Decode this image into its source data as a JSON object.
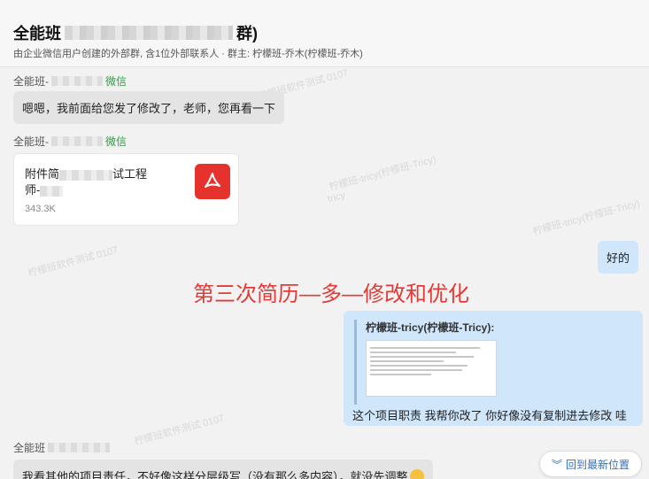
{
  "header": {
    "title_prefix": "全能班",
    "title_suffix": "群)",
    "subtitle": "由企业微信用户创建的外部群, 含1位外部联系人 · 群主: 柠檬班-乔木(柠檬班-乔木)"
  },
  "messages": [
    {
      "sender_prefix": "全能班-",
      "sender_tag": "微信",
      "text": "嗯嗯，我前面给您发了修改了，老师，您再看一下"
    },
    {
      "sender_prefix": "全能班-",
      "sender_tag": "微信",
      "file": {
        "name_prefix": "附件简",
        "name_mid": "试工程",
        "name_suffix": "师-",
        "size": "343.3K",
        "icon": "pdf-icon"
      }
    },
    {
      "outgoing": true,
      "text": "好的"
    },
    {
      "outgoing": true,
      "quote_author": "柠檬班-tricy(柠檬班-Tricy):",
      "text": "这个项目职责 我帮你改了  你好像没有复制进去修改 哇"
    },
    {
      "sender_prefix": "全能班",
      "text": "我看其他的项目责任，不好像这样分层级写（没有那么多内容），就没先调整"
    }
  ],
  "overlay_text": "第三次简历—多—修改和优化",
  "jump_button": {
    "label": "回到最新位置",
    "icon": "double-chevron-down-icon"
  },
  "watermarks": [
    "柠檬班软件测试 0107",
    "柠檬班-tricy(柠檬班-Tricy)",
    "tricy"
  ],
  "colors": {
    "accent": "#2f6fc6",
    "outgoing_bubble": "#cfe6fb",
    "incoming_bubble": "#e4e4e4",
    "overlay": "#e53935",
    "pdf": "#e5322d"
  }
}
